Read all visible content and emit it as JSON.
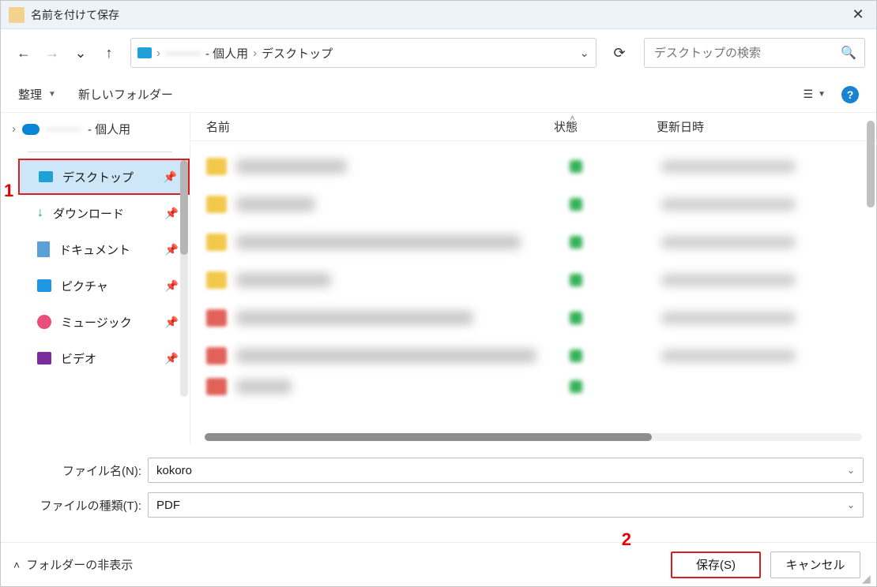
{
  "title": "名前を付けて保存",
  "breadcrumbs": {
    "root_blurred": "———",
    "personal_suffix": "- 個人用",
    "current": "デスクトップ"
  },
  "search": {
    "placeholder": "デスクトップの検索"
  },
  "commandbar": {
    "organize": "整理",
    "newfolder": "新しいフォルダー"
  },
  "navpane": {
    "top_blurred": "———",
    "top_suffix": "- 個人用",
    "items": [
      {
        "label": "デスクトップ",
        "selected": true,
        "icon": "desktop"
      },
      {
        "label": "ダウンロード",
        "selected": false,
        "icon": "download"
      },
      {
        "label": "ドキュメント",
        "selected": false,
        "icon": "doc"
      },
      {
        "label": "ピクチャ",
        "selected": false,
        "icon": "pic"
      },
      {
        "label": "ミュージック",
        "selected": false,
        "icon": "music"
      },
      {
        "label": "ビデオ",
        "selected": false,
        "icon": "video"
      }
    ]
  },
  "list": {
    "columns": {
      "name": "名前",
      "status": "状態",
      "date": "更新日時"
    }
  },
  "fields": {
    "name_label": "ファイル名(N):",
    "name_value": "kokoro",
    "type_label": "ファイルの種類(T):",
    "type_value": "PDF"
  },
  "buttons": {
    "folder_hide": "フォルダーの非表示",
    "save": "保存(S)",
    "cancel": "キャンセル"
  },
  "annotations": {
    "one": "1",
    "two": "2"
  }
}
